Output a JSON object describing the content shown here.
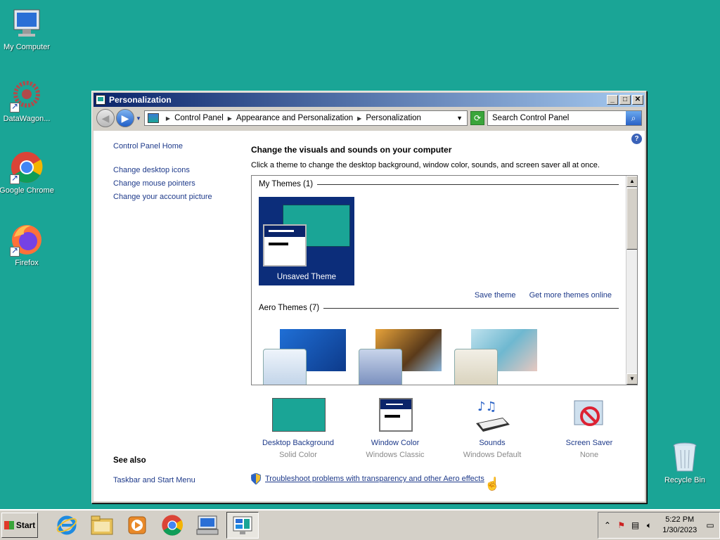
{
  "desktop": {
    "icons": [
      {
        "label": "My Computer"
      },
      {
        "label": "DataWagon..."
      },
      {
        "label": "Google Chrome"
      },
      {
        "label": "Firefox"
      },
      {
        "label": "Recycle Bin"
      }
    ]
  },
  "window": {
    "title": "Personalization",
    "breadcrumb": [
      "Control Panel",
      "Appearance and Personalization",
      "Personalization"
    ],
    "search_placeholder": "Search Control Panel"
  },
  "left_panel": {
    "home": "Control Panel Home",
    "links": [
      "Change desktop icons",
      "Change mouse pointers",
      "Change your account picture"
    ],
    "see_also_title": "See also",
    "see_also_link": "Taskbar and Start Menu"
  },
  "main": {
    "heading": "Change the visuals and sounds on your computer",
    "description": "Click a theme to change the desktop background, window color, sounds, and screen saver all at once.",
    "my_themes_header": "My Themes (1)",
    "unsaved_theme": "Unsaved Theme",
    "save_theme": "Save theme",
    "get_more": "Get more themes online",
    "aero_header": "Aero Themes (7)",
    "bottom_items": [
      {
        "label": "Desktop Background",
        "sub": "Solid Color"
      },
      {
        "label": "Window Color",
        "sub": "Windows Classic"
      },
      {
        "label": "Sounds",
        "sub": "Windows Default"
      },
      {
        "label": "Screen Saver",
        "sub": "None"
      }
    ],
    "troubleshoot": "Troubleshoot problems with transparency and other Aero effects"
  },
  "taskbar": {
    "start": "Start",
    "time": "5:22 PM",
    "date": "1/30/2023"
  },
  "colors": {
    "desktop": "#1aa596",
    "titlebar": "#0a246a",
    "link": "#1e3a8a"
  }
}
